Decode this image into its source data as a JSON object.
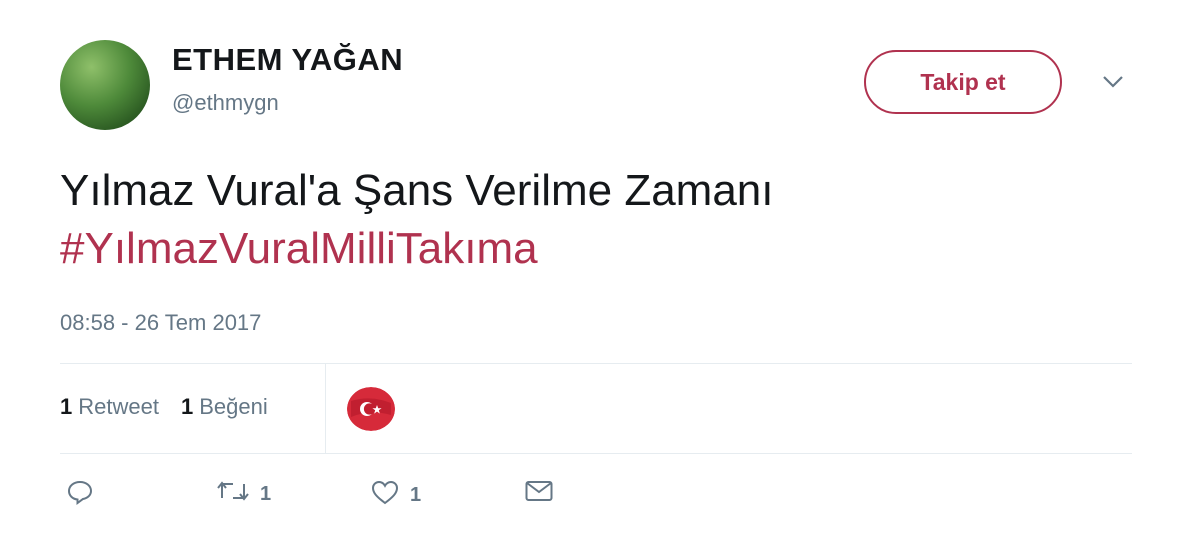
{
  "user": {
    "display_name": "ETHEM YAĞAN",
    "handle": "@ethmygn"
  },
  "follow_button_label": "Takip et",
  "tweet": {
    "text": "Yılmaz Vural'a Şans Verilme Zamanı",
    "hashtag": "#YılmazVuralMilliTakıma",
    "timestamp": "08:58 - 26 Tem 2017"
  },
  "stats": {
    "retweet_count": "1",
    "retweet_label": "Retweet",
    "like_count": "1",
    "like_label": "Beğeni"
  },
  "actions": {
    "reply_icon": "reply-icon",
    "retweet_icon": "retweet-icon",
    "retweet_count": "1",
    "like_icon": "heart-icon",
    "like_count": "1",
    "dm_icon": "envelope-icon"
  },
  "colors": {
    "accent": "#b0324f",
    "muted": "#657786",
    "text": "#14171a"
  }
}
